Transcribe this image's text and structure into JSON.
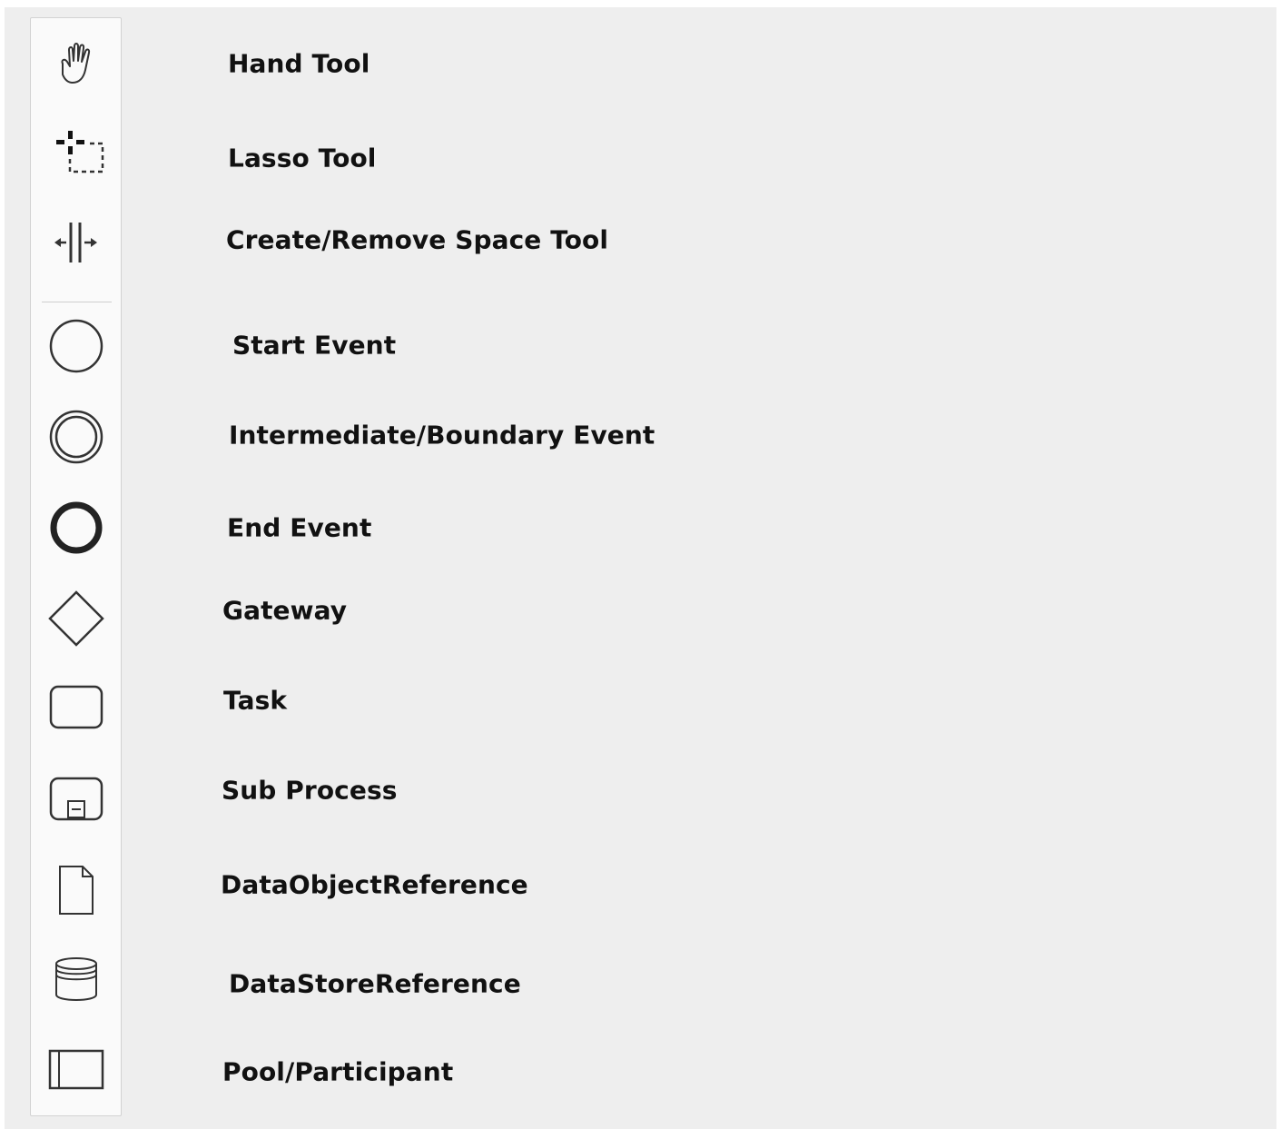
{
  "palette": {
    "items": [
      {
        "icon": "hand-tool-icon",
        "label": "Hand Tool"
      },
      {
        "icon": "lasso-tool-icon",
        "label": "Lasso Tool"
      },
      {
        "icon": "space-tool-icon",
        "label": "Create/Remove Space Tool"
      },
      {
        "icon": "start-event-icon",
        "label": "Start Event"
      },
      {
        "icon": "intermediate-event-icon",
        "label": "Intermediate/Boundary Event"
      },
      {
        "icon": "end-event-icon",
        "label": "End Event"
      },
      {
        "icon": "gateway-icon",
        "label": "Gateway"
      },
      {
        "icon": "task-icon",
        "label": "Task"
      },
      {
        "icon": "subprocess-icon",
        "label": "Sub Process"
      },
      {
        "icon": "data-object-icon",
        "label": "DataObjectReference"
      },
      {
        "icon": "data-store-icon",
        "label": "DataStoreReference"
      },
      {
        "icon": "pool-icon",
        "label": "Pool/Participant"
      }
    ]
  },
  "colors": {
    "canvas": "#eeeeee",
    "palette": "#fafafa",
    "icon_stroke": "#333333",
    "label_text": "#111111"
  }
}
